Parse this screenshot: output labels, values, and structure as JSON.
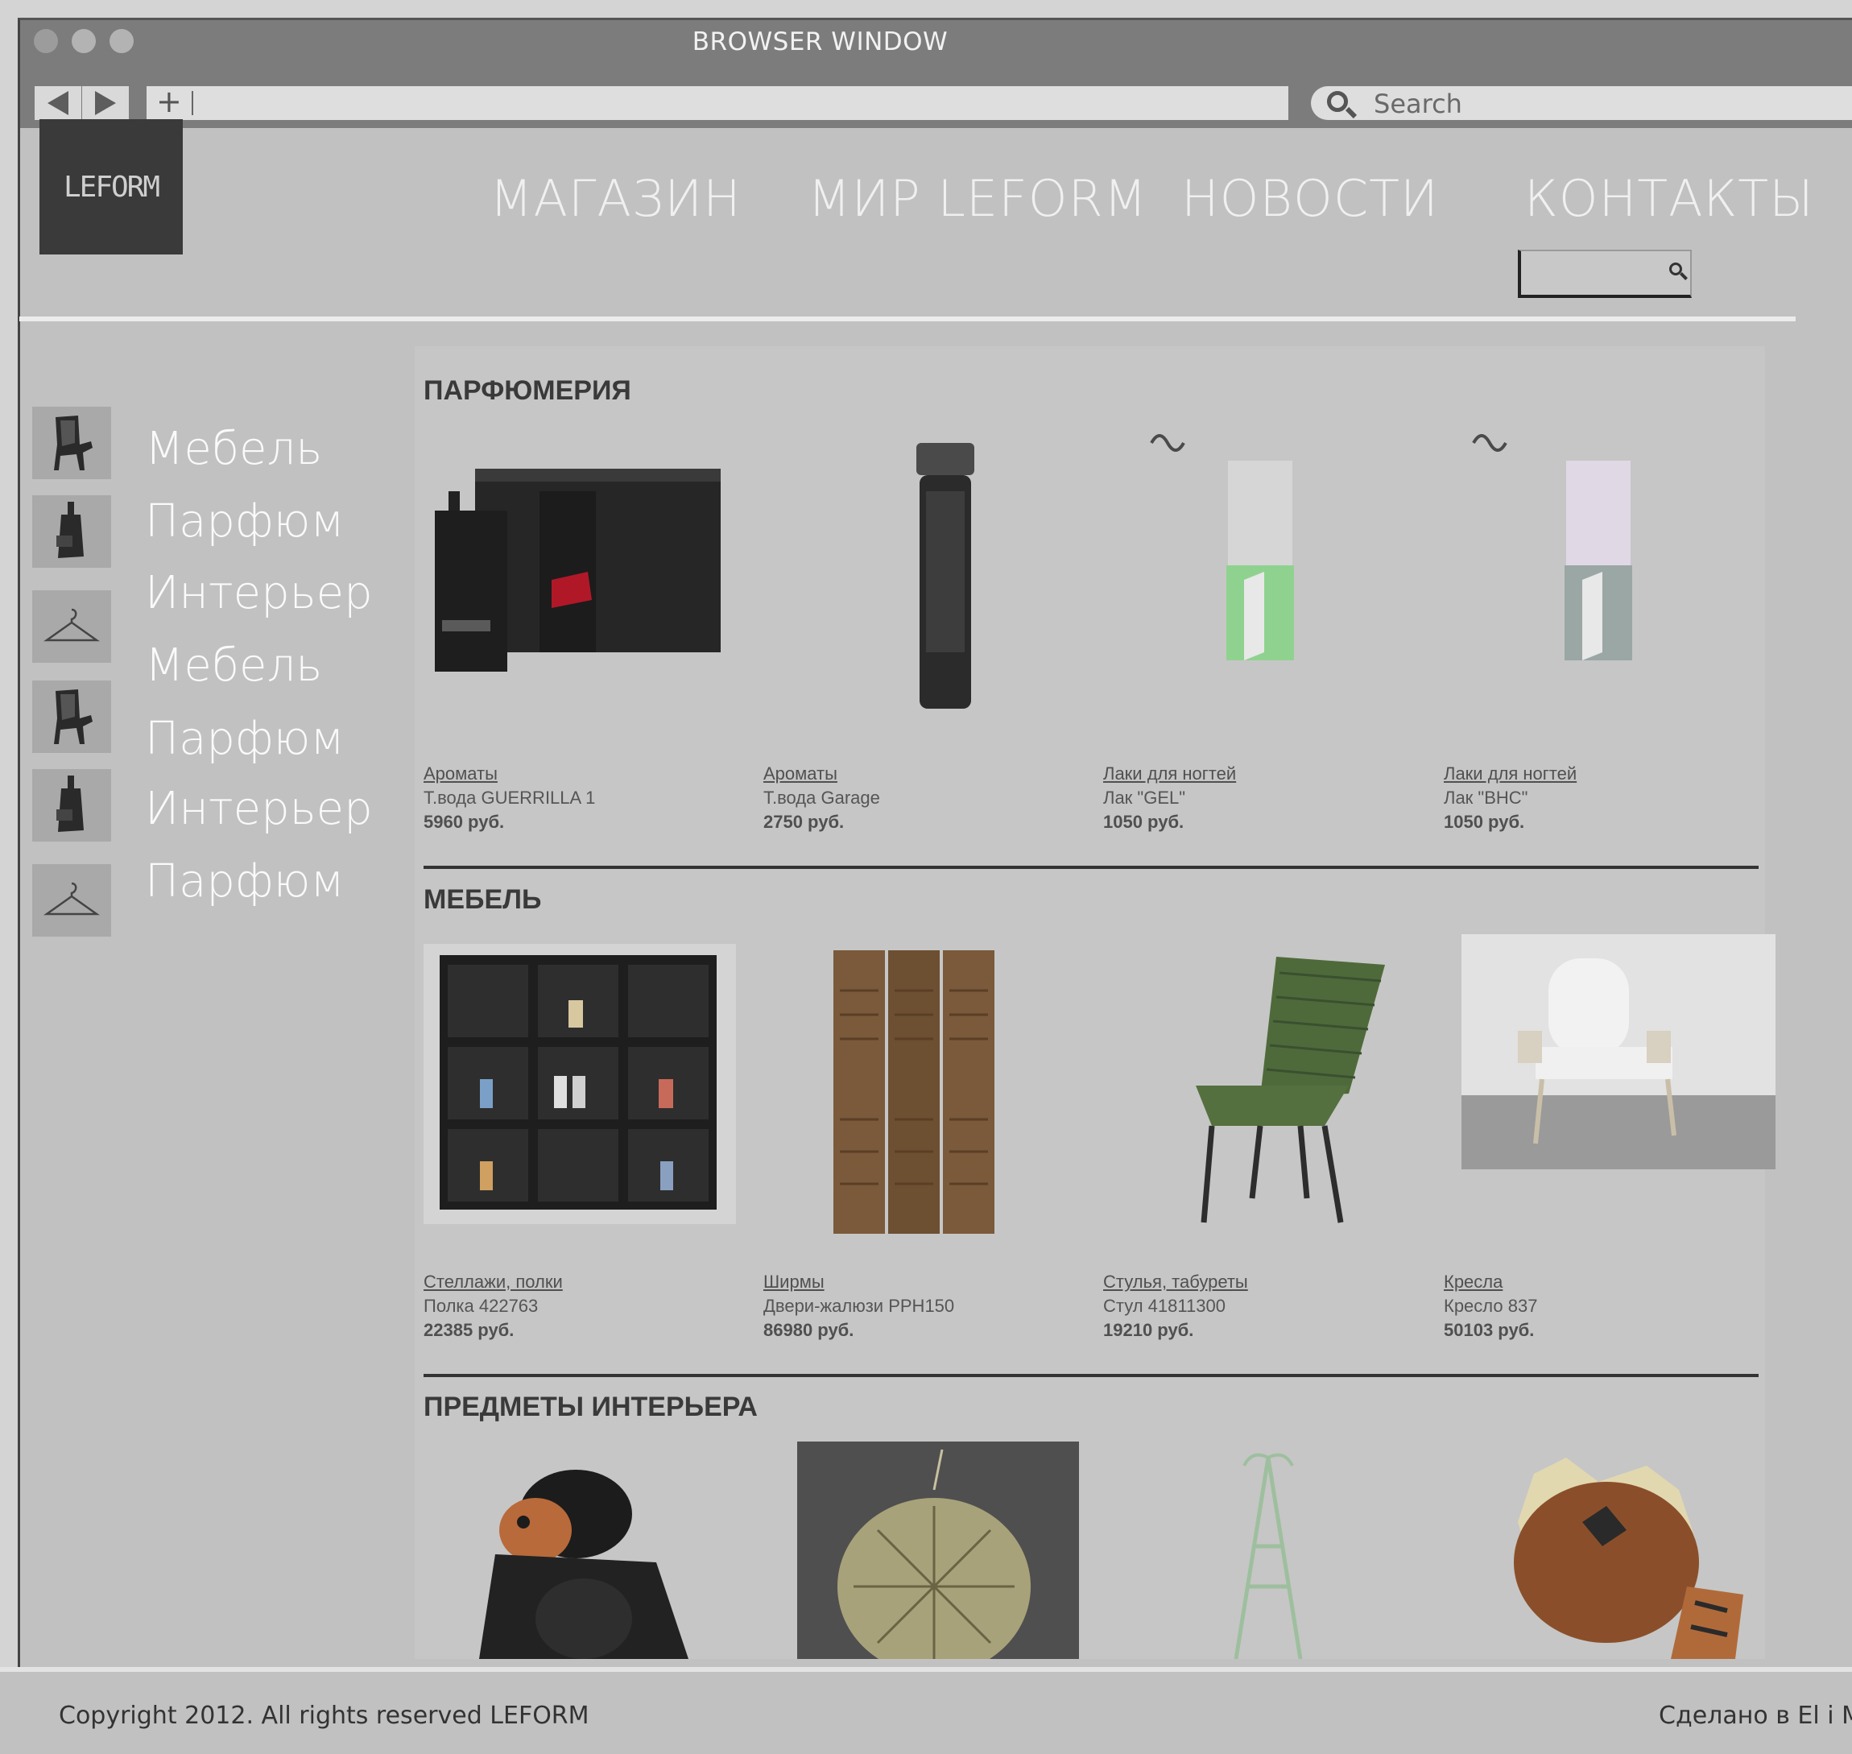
{
  "browser": {
    "title": "BROWSER WINDOW",
    "search_placeholder": "Search"
  },
  "header": {
    "logo": "LEFORM",
    "nav": [
      "МАГАЗИН",
      "МИР LEFORM",
      "НОВОСТИ",
      "КОНТАКТЫ"
    ]
  },
  "sidebar": {
    "items": [
      {
        "label": "Мебель",
        "icon": "chair-icon"
      },
      {
        "label": "Парфюм",
        "icon": "perfume-bottle-icon"
      },
      {
        "label": "Интерьер",
        "icon": "hanger-icon"
      },
      {
        "label": "Мебель",
        "icon": "chair-icon"
      },
      {
        "label": "Парфюм",
        "icon": "perfume-bottle-icon"
      },
      {
        "label": "Интерьер",
        "icon": "hanger-icon"
      },
      {
        "label": "Парфюм"
      }
    ]
  },
  "sections": [
    {
      "title": "ПАРФЮМЕРИЯ",
      "products": [
        {
          "category": "Ароматы",
          "name": "Т.вода GUERRILLA 1",
          "price": "5960 руб."
        },
        {
          "category": "Ароматы",
          "name": "Т.вода Garage",
          "price": "2750 руб."
        },
        {
          "category": "Лаки для ногтей",
          "name": "Лак \"GEL\"",
          "price": "1050 руб."
        },
        {
          "category": "Лаки для ногтей",
          "name": "Лак \"BHC\"",
          "price": "1050 руб."
        }
      ]
    },
    {
      "title": "МЕБЕЛЬ",
      "products": [
        {
          "category": "Стеллажи, полки",
          "name": "Полка 422763",
          "price": "22385 руб."
        },
        {
          "category": "Ширмы",
          "name": "Двери-жалюзи PPH150",
          "price": "86980 руб."
        },
        {
          "category": "Стулья, табуреты",
          "name": "Стул 41811300",
          "price": "19210 руб."
        },
        {
          "category": "Кресла",
          "name": "Кресло 837",
          "price": "50103 руб."
        }
      ]
    },
    {
      "title": "ПРЕДМЕТЫ ИНТЕРЬЕРА",
      "products": []
    }
  ],
  "footer": {
    "copyright": "Copyright 2012. All rights reserved LEFORM",
    "made_in": "Сделано в El i Mot"
  }
}
